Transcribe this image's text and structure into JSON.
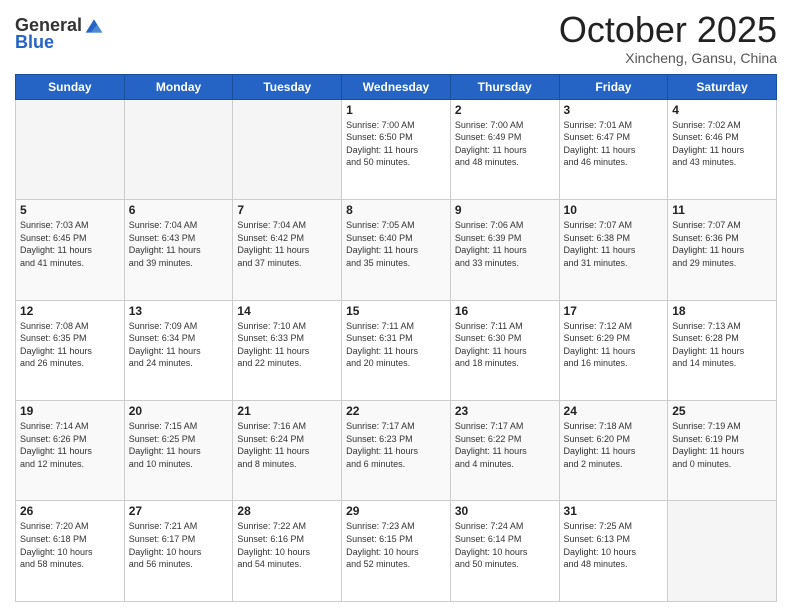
{
  "header": {
    "logo_line1": "General",
    "logo_line2": "Blue",
    "month": "October 2025",
    "location": "Xincheng, Gansu, China"
  },
  "days_of_week": [
    "Sunday",
    "Monday",
    "Tuesday",
    "Wednesday",
    "Thursday",
    "Friday",
    "Saturday"
  ],
  "weeks": [
    [
      {
        "day": "",
        "info": ""
      },
      {
        "day": "",
        "info": ""
      },
      {
        "day": "",
        "info": ""
      },
      {
        "day": "1",
        "info": "Sunrise: 7:00 AM\nSunset: 6:50 PM\nDaylight: 11 hours\nand 50 minutes."
      },
      {
        "day": "2",
        "info": "Sunrise: 7:00 AM\nSunset: 6:49 PM\nDaylight: 11 hours\nand 48 minutes."
      },
      {
        "day": "3",
        "info": "Sunrise: 7:01 AM\nSunset: 6:47 PM\nDaylight: 11 hours\nand 46 minutes."
      },
      {
        "day": "4",
        "info": "Sunrise: 7:02 AM\nSunset: 6:46 PM\nDaylight: 11 hours\nand 43 minutes."
      }
    ],
    [
      {
        "day": "5",
        "info": "Sunrise: 7:03 AM\nSunset: 6:45 PM\nDaylight: 11 hours\nand 41 minutes."
      },
      {
        "day": "6",
        "info": "Sunrise: 7:04 AM\nSunset: 6:43 PM\nDaylight: 11 hours\nand 39 minutes."
      },
      {
        "day": "7",
        "info": "Sunrise: 7:04 AM\nSunset: 6:42 PM\nDaylight: 11 hours\nand 37 minutes."
      },
      {
        "day": "8",
        "info": "Sunrise: 7:05 AM\nSunset: 6:40 PM\nDaylight: 11 hours\nand 35 minutes."
      },
      {
        "day": "9",
        "info": "Sunrise: 7:06 AM\nSunset: 6:39 PM\nDaylight: 11 hours\nand 33 minutes."
      },
      {
        "day": "10",
        "info": "Sunrise: 7:07 AM\nSunset: 6:38 PM\nDaylight: 11 hours\nand 31 minutes."
      },
      {
        "day": "11",
        "info": "Sunrise: 7:07 AM\nSunset: 6:36 PM\nDaylight: 11 hours\nand 29 minutes."
      }
    ],
    [
      {
        "day": "12",
        "info": "Sunrise: 7:08 AM\nSunset: 6:35 PM\nDaylight: 11 hours\nand 26 minutes."
      },
      {
        "day": "13",
        "info": "Sunrise: 7:09 AM\nSunset: 6:34 PM\nDaylight: 11 hours\nand 24 minutes."
      },
      {
        "day": "14",
        "info": "Sunrise: 7:10 AM\nSunset: 6:33 PM\nDaylight: 11 hours\nand 22 minutes."
      },
      {
        "day": "15",
        "info": "Sunrise: 7:11 AM\nSunset: 6:31 PM\nDaylight: 11 hours\nand 20 minutes."
      },
      {
        "day": "16",
        "info": "Sunrise: 7:11 AM\nSunset: 6:30 PM\nDaylight: 11 hours\nand 18 minutes."
      },
      {
        "day": "17",
        "info": "Sunrise: 7:12 AM\nSunset: 6:29 PM\nDaylight: 11 hours\nand 16 minutes."
      },
      {
        "day": "18",
        "info": "Sunrise: 7:13 AM\nSunset: 6:28 PM\nDaylight: 11 hours\nand 14 minutes."
      }
    ],
    [
      {
        "day": "19",
        "info": "Sunrise: 7:14 AM\nSunset: 6:26 PM\nDaylight: 11 hours\nand 12 minutes."
      },
      {
        "day": "20",
        "info": "Sunrise: 7:15 AM\nSunset: 6:25 PM\nDaylight: 11 hours\nand 10 minutes."
      },
      {
        "day": "21",
        "info": "Sunrise: 7:16 AM\nSunset: 6:24 PM\nDaylight: 11 hours\nand 8 minutes."
      },
      {
        "day": "22",
        "info": "Sunrise: 7:17 AM\nSunset: 6:23 PM\nDaylight: 11 hours\nand 6 minutes."
      },
      {
        "day": "23",
        "info": "Sunrise: 7:17 AM\nSunset: 6:22 PM\nDaylight: 11 hours\nand 4 minutes."
      },
      {
        "day": "24",
        "info": "Sunrise: 7:18 AM\nSunset: 6:20 PM\nDaylight: 11 hours\nand 2 minutes."
      },
      {
        "day": "25",
        "info": "Sunrise: 7:19 AM\nSunset: 6:19 PM\nDaylight: 11 hours\nand 0 minutes."
      }
    ],
    [
      {
        "day": "26",
        "info": "Sunrise: 7:20 AM\nSunset: 6:18 PM\nDaylight: 10 hours\nand 58 minutes."
      },
      {
        "day": "27",
        "info": "Sunrise: 7:21 AM\nSunset: 6:17 PM\nDaylight: 10 hours\nand 56 minutes."
      },
      {
        "day": "28",
        "info": "Sunrise: 7:22 AM\nSunset: 6:16 PM\nDaylight: 10 hours\nand 54 minutes."
      },
      {
        "day": "29",
        "info": "Sunrise: 7:23 AM\nSunset: 6:15 PM\nDaylight: 10 hours\nand 52 minutes."
      },
      {
        "day": "30",
        "info": "Sunrise: 7:24 AM\nSunset: 6:14 PM\nDaylight: 10 hours\nand 50 minutes."
      },
      {
        "day": "31",
        "info": "Sunrise: 7:25 AM\nSunset: 6:13 PM\nDaylight: 10 hours\nand 48 minutes."
      },
      {
        "day": "",
        "info": ""
      }
    ]
  ]
}
